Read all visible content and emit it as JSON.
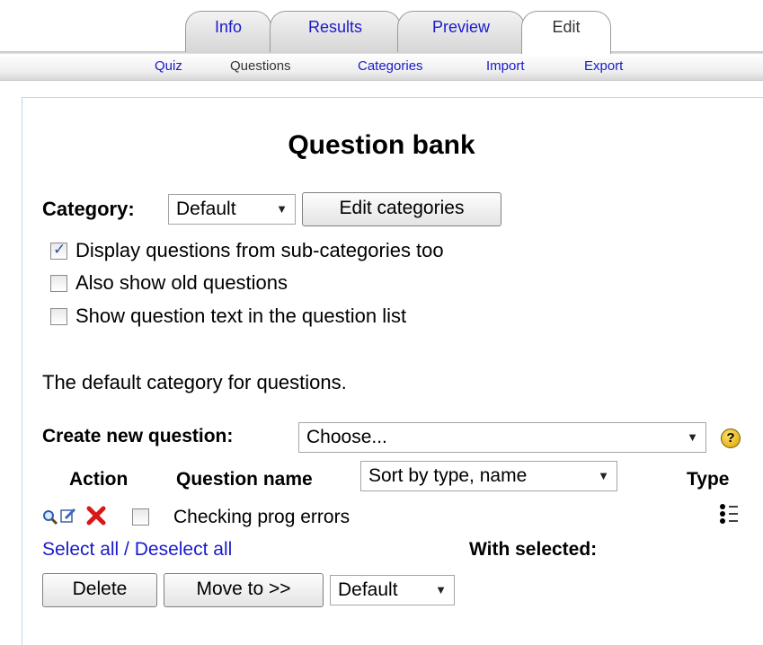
{
  "tabs": [
    {
      "label": "Info",
      "selected": false
    },
    {
      "label": "Results",
      "selected": false
    },
    {
      "label": "Preview",
      "selected": false
    },
    {
      "label": "Edit",
      "selected": true
    }
  ],
  "subtabs": [
    {
      "label": "Quiz",
      "current": false
    },
    {
      "label": "Questions",
      "current": true
    },
    {
      "label": "Categories",
      "current": false
    },
    {
      "label": "Import",
      "current": false
    },
    {
      "label": "Export",
      "current": false
    }
  ],
  "page_title": "Question bank",
  "category": {
    "label": "Category:",
    "selected": "Default",
    "edit_button": "Edit categories"
  },
  "options": [
    {
      "label": "Display questions from sub-categories too",
      "checked": true
    },
    {
      "label": "Also show old questions",
      "checked": false
    },
    {
      "label": "Show question text in the question list",
      "checked": false
    }
  ],
  "category_description": "The default category for questions.",
  "create": {
    "label": "Create new question:",
    "selected": "Choose...",
    "help_icon": "help-icon"
  },
  "table": {
    "headers": {
      "action": "Action",
      "question_name": "Question name",
      "sort_selected": "Sort by type, name",
      "type": "Type"
    },
    "rows": [
      {
        "action_icons": [
          "preview-icon",
          "edit-icon",
          "delete-icon"
        ],
        "checked": false,
        "name": "Checking prog errors",
        "type_icon": "multichoice-icon"
      }
    ]
  },
  "select_all": "Select all",
  "separator": " / ",
  "deselect_all": "Deselect all",
  "with_selected": "With selected:",
  "buttons": {
    "delete": "Delete",
    "move_to": "Move to >>"
  },
  "move_target": "Default",
  "colors": {
    "link": "#1a1acc",
    "box_border": "#b9d8ee",
    "delete_icon": "#d81818",
    "help_icon": "#e8b400"
  }
}
